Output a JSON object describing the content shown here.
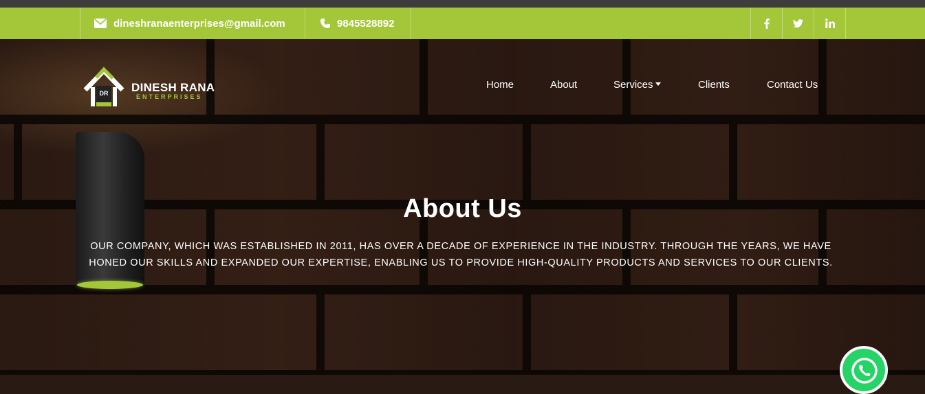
{
  "topbar": {
    "email": "dineshranaenterprises@gmail.com",
    "phone": "9845528892",
    "social": [
      {
        "name": "facebook-icon",
        "label": "f"
      },
      {
        "name": "twitter-icon",
        "label": "t"
      },
      {
        "name": "linkedin-icon",
        "label": "in"
      }
    ]
  },
  "logo": {
    "badge": "DR",
    "name": "DINESH RANA",
    "sub": "ENTERPRISES"
  },
  "nav": {
    "home": "Home",
    "about": "About",
    "services": "Services",
    "clients": "Clients",
    "contact": "Contact Us"
  },
  "hero": {
    "title": "About Us",
    "text": "Our company, which was established in 2011, has over a decade of experience in the industry. Through the years, we have honed our skills and expanded our expertise, enabling us to provide high-quality products and services to our clients."
  },
  "colors": {
    "accent": "#a4c639",
    "dark_strip": "#3d3d3b",
    "whatsapp": "#25d366"
  }
}
